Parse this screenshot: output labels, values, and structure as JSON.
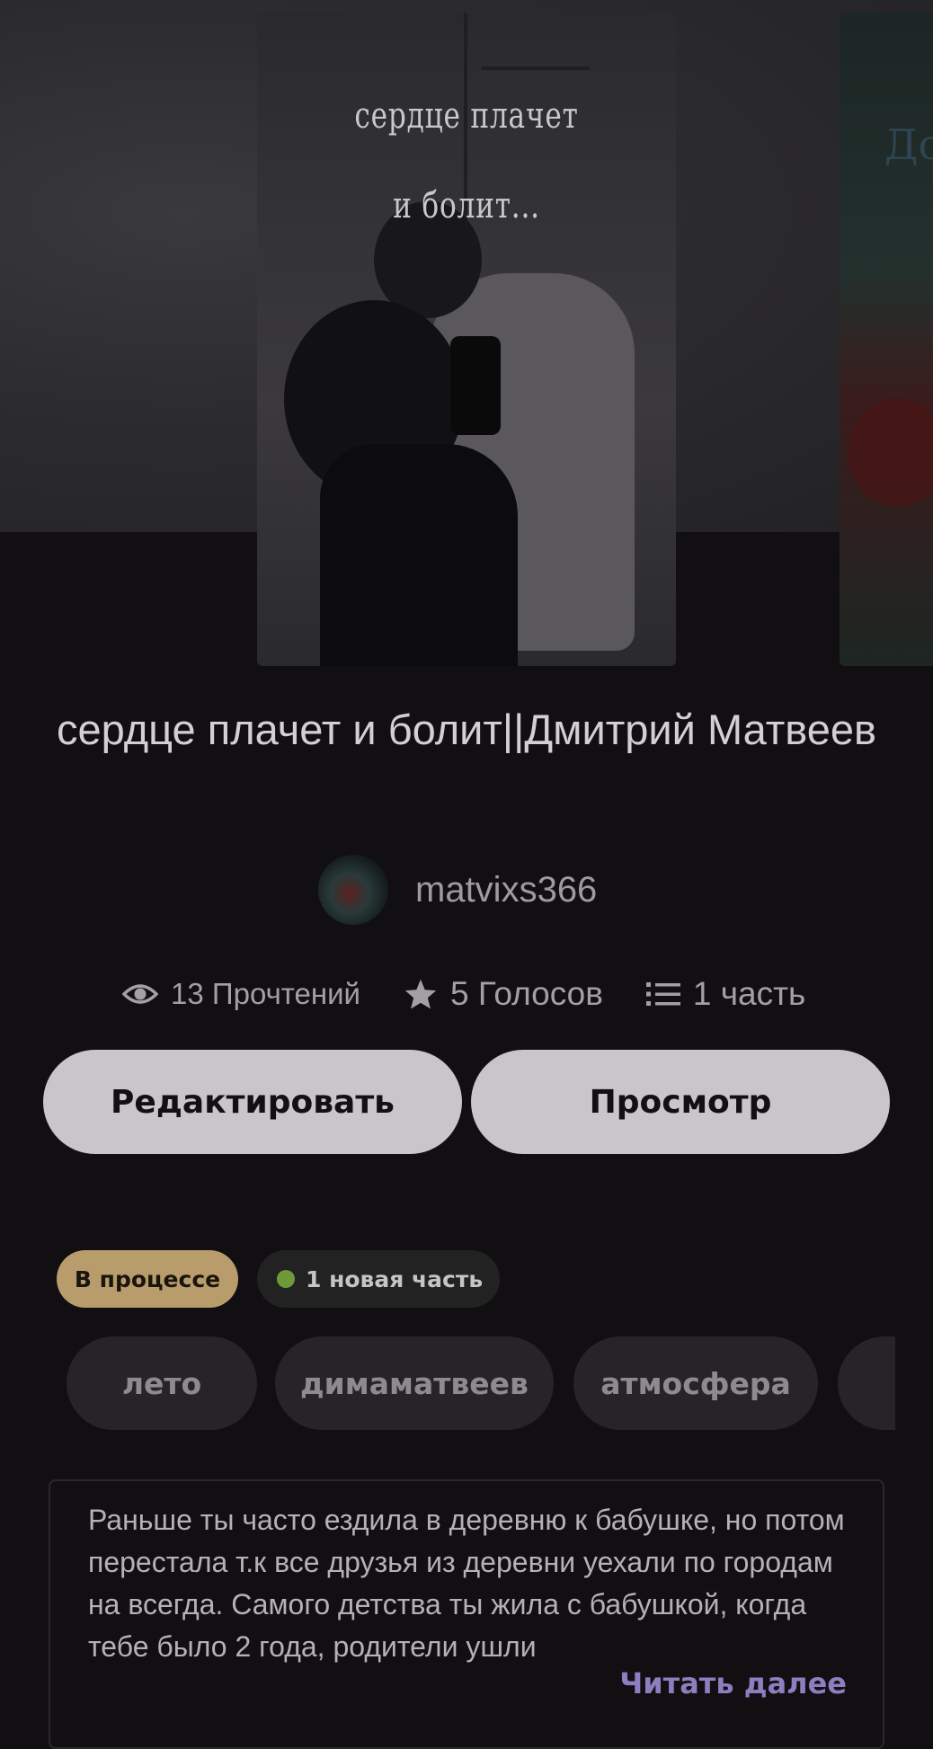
{
  "cover": {
    "title_line1": "сердце плачет",
    "title_line2": "и болит..."
  },
  "side_cover": {
    "partial_text": "До"
  },
  "story": {
    "title": "сердце плачет и болит||Дмитрий Матвеев",
    "author": "matvixs366"
  },
  "stats": {
    "reads": "13 Прочтений",
    "votes": "5 Голосов",
    "parts": "1 часть"
  },
  "buttons": {
    "edit": "Редактировать",
    "view": "Просмотр"
  },
  "badges": {
    "status": "В процессе",
    "new_parts": "1 новая часть"
  },
  "tags": [
    "лето",
    "димаматвеев",
    "атмосфера",
    ""
  ],
  "description": {
    "text": "Раньше ты часто ездила в деревню к бабушке, но потом перестала т.к все друзья из деревни уехали по городам на всегда. Самого детства ты жила с бабушкой, когда тебе было 2 года, родители ушли",
    "read_more": "Читать далее"
  },
  "colors": {
    "background": "#110f12",
    "button": "#c9c5ca",
    "status_badge": "#b99c6c",
    "new_dot": "#6e9a3a",
    "read_more": "#8b7fc0"
  }
}
